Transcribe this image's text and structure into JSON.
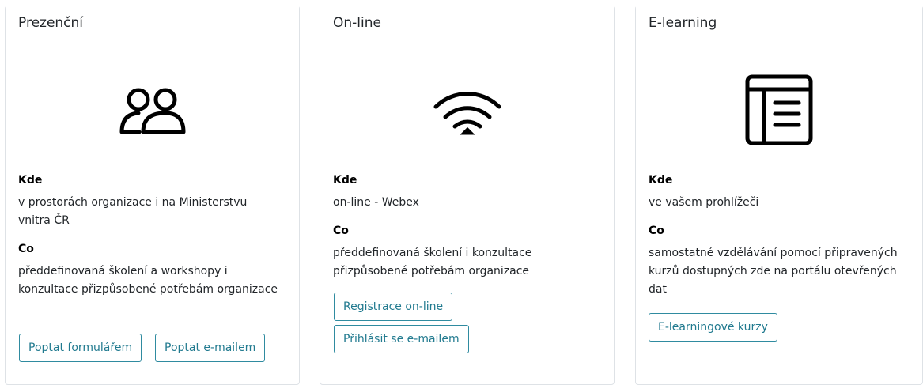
{
  "cards": [
    {
      "title": "Prezenční",
      "icon": "people-icon",
      "where_label": "Kde",
      "where_text": "v prostorách organizace i na Ministerstvu vnitra ČR",
      "what_label": "Co",
      "what_text": "předdefinovaná školení a workshopy i konzultace přizpůsobené potřebám organizace",
      "buttons": [
        "Poptat formulářem",
        "Poptat e-mailem"
      ]
    },
    {
      "title": "On-line",
      "icon": "wifi-icon",
      "where_label": "Kde",
      "where_text": "on-line - Webex",
      "what_label": "Co",
      "what_text": "předdefinovaná školení i konzultace přizpůsobené potřebám organizace",
      "buttons": [
        "Registrace on-line",
        "Přihlásit se e-mailem"
      ]
    },
    {
      "title": "E-learning",
      "icon": "layout-text-window-icon",
      "where_label": "Kde",
      "where_text": "ve vašem prohlížeči",
      "what_label": "Co",
      "what_text": "samostatné vzdělávání pomocí připravených kurzů dostupných zde na portálu otevřených dat",
      "buttons": [
        "E-learningové kurzy"
      ]
    }
  ],
  "colors": {
    "border": "#dee2e6",
    "button_border": "#2f8ba0",
    "button_text": "#217a8f",
    "text": "#212529"
  }
}
